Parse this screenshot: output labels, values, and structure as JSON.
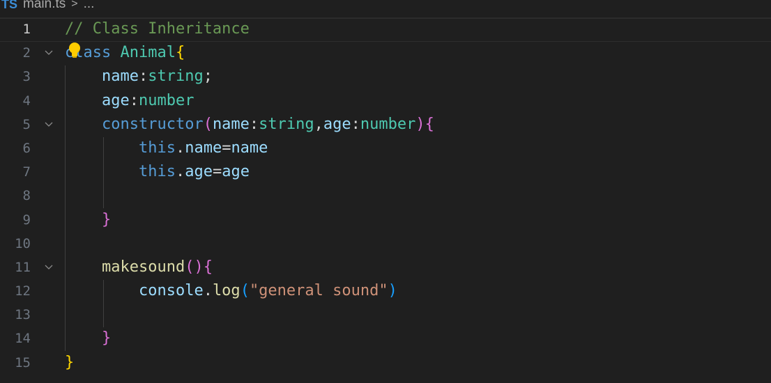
{
  "breadcrumb": {
    "lang_badge": "TS",
    "file": "main.ts",
    "separator": ">",
    "ellipsis": "..."
  },
  "editor": {
    "active_line": 1,
    "lines": [
      {
        "n": "1",
        "tokens": [
          {
            "t": "// Class Inheritance",
            "c": "comment"
          }
        ]
      },
      {
        "n": "2",
        "tokens": [
          {
            "t": "class",
            "c": "kw"
          },
          {
            "t": " ",
            "c": "plain"
          },
          {
            "t": "Animal",
            "c": "cls"
          },
          {
            "t": "{",
            "c": "b1"
          }
        ]
      },
      {
        "n": "3",
        "tokens": [
          {
            "t": "    ",
            "c": "plain"
          },
          {
            "t": "name",
            "c": "prop"
          },
          {
            "t": ":",
            "c": "plain"
          },
          {
            "t": "string",
            "c": "type"
          },
          {
            "t": ";",
            "c": "plain"
          }
        ]
      },
      {
        "n": "4",
        "tokens": [
          {
            "t": "    ",
            "c": "plain"
          },
          {
            "t": "age",
            "c": "prop"
          },
          {
            "t": ":",
            "c": "plain"
          },
          {
            "t": "number",
            "c": "type"
          }
        ]
      },
      {
        "n": "5",
        "tokens": [
          {
            "t": "    ",
            "c": "plain"
          },
          {
            "t": "constructor",
            "c": "kw"
          },
          {
            "t": "(",
            "c": "b2"
          },
          {
            "t": "name",
            "c": "prop"
          },
          {
            "t": ":",
            "c": "plain"
          },
          {
            "t": "string",
            "c": "type"
          },
          {
            "t": ",",
            "c": "plain"
          },
          {
            "t": "age",
            "c": "prop"
          },
          {
            "t": ":",
            "c": "plain"
          },
          {
            "t": "number",
            "c": "type"
          },
          {
            "t": ")",
            "c": "b2"
          },
          {
            "t": "{",
            "c": "b2"
          }
        ]
      },
      {
        "n": "6",
        "tokens": [
          {
            "t": "        ",
            "c": "plain"
          },
          {
            "t": "this",
            "c": "kw"
          },
          {
            "t": ".",
            "c": "plain"
          },
          {
            "t": "name",
            "c": "prop"
          },
          {
            "t": "=",
            "c": "plain"
          },
          {
            "t": "name",
            "c": "prop"
          }
        ]
      },
      {
        "n": "7",
        "tokens": [
          {
            "t": "        ",
            "c": "plain"
          },
          {
            "t": "this",
            "c": "kw"
          },
          {
            "t": ".",
            "c": "plain"
          },
          {
            "t": "age",
            "c": "prop"
          },
          {
            "t": "=",
            "c": "plain"
          },
          {
            "t": "age",
            "c": "prop"
          }
        ]
      },
      {
        "n": "8",
        "tokens": []
      },
      {
        "n": "9",
        "tokens": [
          {
            "t": "    ",
            "c": "plain"
          },
          {
            "t": "}",
            "c": "b2"
          }
        ]
      },
      {
        "n": "10",
        "tokens": []
      },
      {
        "n": "11",
        "tokens": [
          {
            "t": "    ",
            "c": "plain"
          },
          {
            "t": "makesound",
            "c": "fn"
          },
          {
            "t": "()",
            "c": "b2"
          },
          {
            "t": "{",
            "c": "b2"
          }
        ]
      },
      {
        "n": "12",
        "tokens": [
          {
            "t": "        ",
            "c": "plain"
          },
          {
            "t": "console",
            "c": "prop"
          },
          {
            "t": ".",
            "c": "plain"
          },
          {
            "t": "log",
            "c": "fn"
          },
          {
            "t": "(",
            "c": "b3"
          },
          {
            "t": "\"general sound\"",
            "c": "str"
          },
          {
            "t": ")",
            "c": "b3"
          }
        ]
      },
      {
        "n": "13",
        "tokens": []
      },
      {
        "n": "14",
        "tokens": [
          {
            "t": "    ",
            "c": "plain"
          },
          {
            "t": "}",
            "c": "b2"
          }
        ]
      },
      {
        "n": "15",
        "tokens": [
          {
            "t": "}",
            "c": "b1"
          }
        ]
      }
    ],
    "foldable_lines": [
      "2",
      "5",
      "11"
    ]
  },
  "colors": {
    "background": "#1f1f1f",
    "comment": "#6a9955",
    "keyword": "#569cd6",
    "type": "#4ec9b0",
    "property": "#9cdcfe",
    "function": "#dcdcaa",
    "string": "#ce9178",
    "bracket_1": "#ffd700",
    "bracket_2": "#da70d6",
    "bracket_3": "#179fff"
  },
  "icons": [
    "typescript-icon",
    "chevron-right-icon",
    "chevron-down-icon",
    "lightbulb-icon"
  ]
}
